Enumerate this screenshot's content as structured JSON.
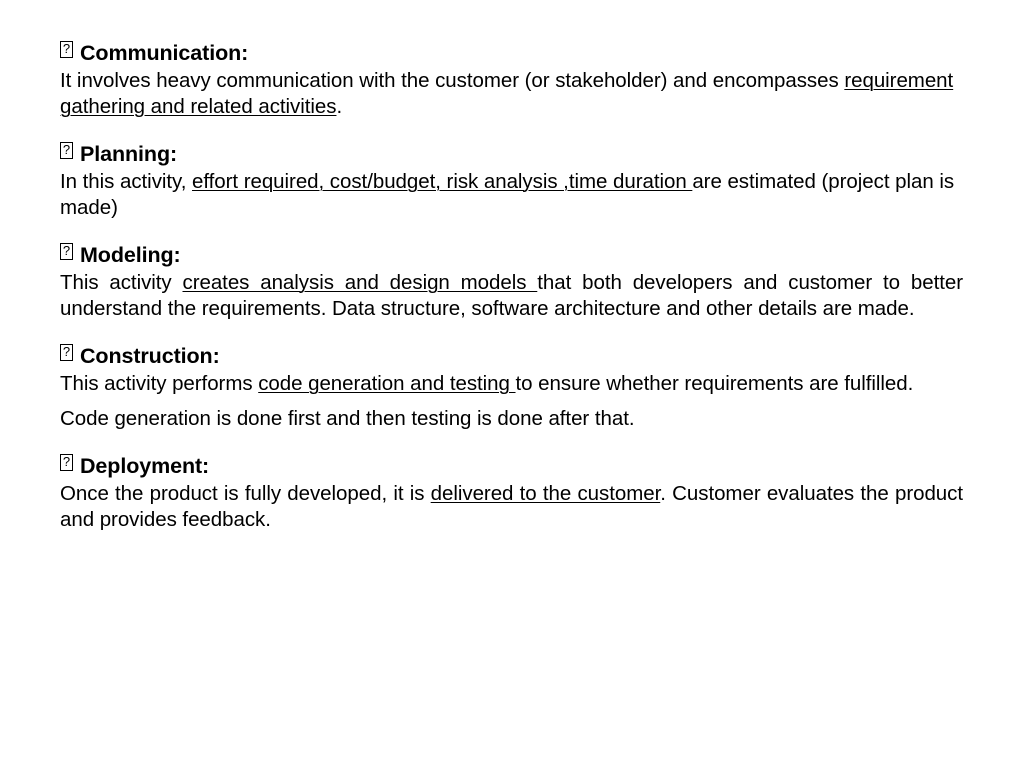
{
  "slide": {
    "background_color": "#ffffff",
    "text_color": "#000000",
    "bullet_glyph": "?",
    "bullet_icon_name": "missing-glyph-box-bullet",
    "sections": [
      {
        "id": "communication",
        "heading": "Communication:",
        "paragraphs": [
          {
            "align": "left",
            "runs": [
              {
                "text": "It involves heavy communication with the customer (or stakeholder) and encompasses ",
                "underline": false
              },
              {
                "text": "requirement gathering and related activities",
                "underline": true
              },
              {
                "text": ".",
                "underline": false
              }
            ]
          }
        ]
      },
      {
        "id": "planning",
        "heading": "Planning:",
        "paragraphs": [
          {
            "align": "left",
            "runs": [
              {
                "text": "In this activity, ",
                "underline": false
              },
              {
                "text": "effort required, cost/budget, risk analysis ,time duration ",
                "underline": true
              },
              {
                "text": "are estimated (project plan is made)",
                "underline": false
              }
            ]
          }
        ]
      },
      {
        "id": "modeling",
        "heading": "Modeling:",
        "paragraphs": [
          {
            "align": "justify",
            "runs": [
              {
                "text": "This activity ",
                "underline": false
              },
              {
                "text": "creates analysis and design models ",
                "underline": true
              },
              {
                "text": "that both developers and customer to better understand the requirements. Data structure, software architecture and other details are made.",
                "underline": false
              }
            ]
          }
        ]
      },
      {
        "id": "construction",
        "heading": "Construction:",
        "paragraphs": [
          {
            "align": "justify",
            "runs": [
              {
                "text": "This activity performs ",
                "underline": false
              },
              {
                "text": "code generation and testing ",
                "underline": true
              },
              {
                "text": "to ensure whether requirements are fulfilled.",
                "underline": false
              }
            ]
          },
          {
            "align": "left",
            "runs": [
              {
                "text": "Code generation is done first and then testing is done after that.",
                "underline": false
              }
            ]
          }
        ]
      },
      {
        "id": "deployment",
        "heading": "Deployment:",
        "paragraphs": [
          {
            "align": "justify",
            "runs": [
              {
                "text": "Once the product is fully developed, it is ",
                "underline": false
              },
              {
                "text": "delivered to the customer",
                "underline": true
              },
              {
                "text": ". Customer evaluates the product and provides feedback.",
                "underline": false
              }
            ]
          }
        ]
      }
    ]
  }
}
